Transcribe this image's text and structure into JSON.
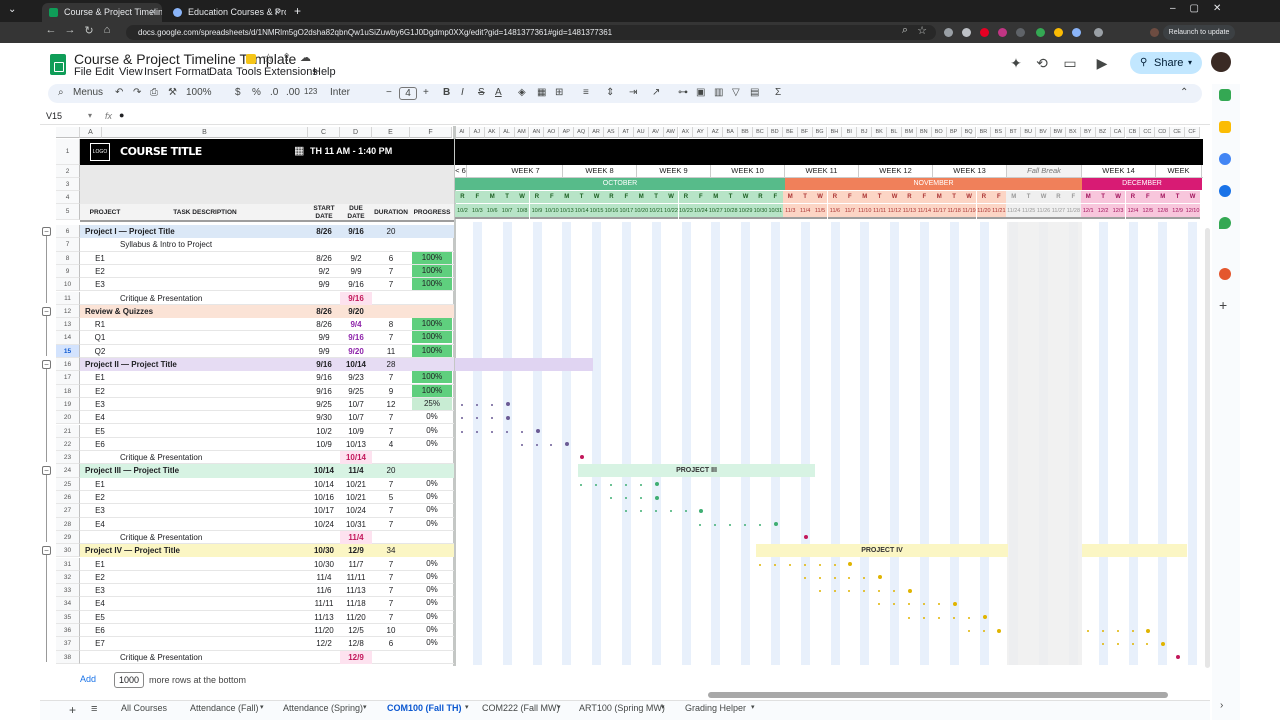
{
  "browser": {
    "tabs": [
      {
        "title": "Course & Project Timeline Templat",
        "active": true
      },
      {
        "title": "Education Courses & Projects T",
        "active": false
      }
    ],
    "url": "docs.google.com/spreadsheets/d/1NMRlm5gO2dsha82qbnQw1uSiZuwby6G1J0Dgdmp0XXg/edit?gid=1481377361#gid=1481377361",
    "relaunch_label": "Relaunch to update"
  },
  "doc": {
    "title": "Course & Project Timeline Template",
    "menus": [
      "File",
      "Edit",
      "View",
      "Insert",
      "Format",
      "Data",
      "Tools",
      "Extensions",
      "Help"
    ],
    "share_label": "Share"
  },
  "toolbar": {
    "menus_label": "Menus",
    "zoom": "100%",
    "currency": "$",
    "percent": "%",
    "dec_less": ".0",
    "dec_more": ".00",
    "format123": "123",
    "font": "Inter",
    "font_size": "4"
  },
  "formula": {
    "cell_ref": "V15",
    "fx": "fx",
    "content": "●"
  },
  "columns": [
    "A",
    "B",
    "C",
    "D",
    "E",
    "F"
  ],
  "timeline_columns": [
    "AI",
    "AJ",
    "AK",
    "AL",
    "AM",
    "AN",
    "AO",
    "AP",
    "AQ",
    "AR",
    "AS",
    "AT",
    "AU",
    "AV",
    "AW",
    "AX",
    "AY",
    "AZ",
    "BA",
    "BB",
    "BC",
    "BD",
    "BE",
    "BF",
    "BG",
    "BH",
    "BI",
    "BJ",
    "BK",
    "BL",
    "BM",
    "BN",
    "BO",
    "BP",
    "BQ",
    "BR",
    "BS",
    "BT",
    "BU",
    "BV",
    "BW",
    "BX",
    "BY",
    "BZ",
    "CA",
    "CB",
    "CC",
    "CD",
    "CE",
    "CF"
  ],
  "header": {
    "logo": "LOGO",
    "course_title": "COURSE TITLE",
    "schedule": "TH 11 AM - 1:40 PM",
    "col_labels": {
      "project": "PROJECT",
      "task": "TASK DESCRIPTION",
      "start": "START DATE",
      "due": "DUE DATE",
      "duration": "DURATION",
      "progress": "PROGRESS"
    }
  },
  "weeks": [
    "< 6",
    "WEEK 7",
    "WEEK 8",
    "WEEK 9",
    "WEEK 10",
    "WEEK 11",
    "WEEK 12",
    "WEEK 13",
    "Fall Break",
    "WEEK 14",
    "WEEK"
  ],
  "months": [
    "OCTOBER",
    "NOVEMBER",
    "DECEMBER"
  ],
  "day_letters": [
    "R",
    "F",
    "M",
    "T",
    "W",
    "R",
    "F",
    "M",
    "T",
    "W",
    "R",
    "F",
    "M",
    "T",
    "W",
    "R",
    "F",
    "M",
    "T",
    "W",
    "R",
    "F",
    "M",
    "T",
    "W",
    "R",
    "F",
    "M",
    "T",
    "W",
    "R",
    "F",
    "M",
    "T",
    "W",
    "R",
    "F",
    "M",
    "T",
    "W",
    "R",
    "F",
    "M",
    "T",
    "W",
    "R",
    "F",
    "M",
    "T",
    "W"
  ],
  "day_dates": [
    "10/2",
    "10/3",
    "10/6",
    "10/7",
    "10/8",
    "10/9",
    "10/10",
    "10/13",
    "10/14",
    "10/15",
    "10/16",
    "10/17",
    "10/20",
    "10/21",
    "10/22",
    "10/23",
    "10/24",
    "10/27",
    "10/28",
    "10/29",
    "10/30",
    "10/31",
    "11/3",
    "11/4",
    "11/5",
    "11/6",
    "11/7",
    "11/10",
    "11/11",
    "11/12",
    "11/13",
    "11/14",
    "11/17",
    "11/18",
    "11/19",
    "11/20",
    "11/21",
    "11/24",
    "11/25",
    "11/26",
    "11/27",
    "11/28",
    "12/1",
    "12/2",
    "12/3",
    "12/4",
    "12/5",
    "12/8",
    "12/9",
    "12/10"
  ],
  "rows": [
    {
      "n": "6",
      "type": "project",
      "a": "Project I — Project Title",
      "c": "8/26",
      "d": "9/16",
      "e": "20",
      "f": "",
      "color": "#dbe8f7"
    },
    {
      "n": "7",
      "type": "task",
      "a": "",
      "b": "Syllabus & Intro to Project",
      "c": "",
      "d": "",
      "e": "",
      "f": ""
    },
    {
      "n": "8",
      "type": "task",
      "a": "E1",
      "b": "",
      "c": "8/26",
      "d": "9/2",
      "e": "6",
      "f": "100%"
    },
    {
      "n": "9",
      "type": "task",
      "a": "E2",
      "b": "",
      "c": "9/2",
      "d": "9/9",
      "e": "7",
      "f": "100%"
    },
    {
      "n": "10",
      "type": "task",
      "a": "E3",
      "b": "",
      "c": "9/9",
      "d": "9/16",
      "e": "7",
      "f": "100%"
    },
    {
      "n": "11",
      "type": "crit",
      "a": "",
      "b": "Critique & Presentation",
      "c": "",
      "d": "9/16",
      "e": "",
      "f": ""
    },
    {
      "n": "12",
      "type": "project",
      "a": "Review & Quizzes",
      "c": "8/26",
      "d": "9/20",
      "e": "",
      "f": "",
      "color": "#fbe3d6"
    },
    {
      "n": "13",
      "type": "task",
      "a": "R1",
      "b": "",
      "c": "8/26",
      "d": "9/4",
      "e": "8",
      "f": "100%",
      "dbold": true
    },
    {
      "n": "14",
      "type": "task",
      "a": "Q1",
      "b": "",
      "c": "9/9",
      "d": "9/16",
      "e": "7",
      "f": "100%",
      "dbold": true
    },
    {
      "n": "15",
      "type": "task",
      "a": "Q2",
      "b": "",
      "c": "9/9",
      "d": "9/20",
      "e": "11",
      "f": "100%",
      "dbold": true
    },
    {
      "n": "16",
      "type": "project",
      "a": "Project II — Project Title",
      "c": "9/16",
      "d": "10/14",
      "e": "28",
      "f": "",
      "color": "#e6dcf3"
    },
    {
      "n": "17",
      "type": "task",
      "a": "E1",
      "b": "",
      "c": "9/16",
      "d": "9/23",
      "e": "7",
      "f": "100%"
    },
    {
      "n": "18",
      "type": "task",
      "a": "E2",
      "b": "",
      "c": "9/16",
      "d": "9/25",
      "e": "9",
      "f": "100%"
    },
    {
      "n": "19",
      "type": "task",
      "a": "E3",
      "b": "",
      "c": "9/25",
      "d": "10/7",
      "e": "12",
      "f": "25%"
    },
    {
      "n": "20",
      "type": "task",
      "a": "E4",
      "b": "",
      "c": "9/30",
      "d": "10/7",
      "e": "7",
      "f": "0%"
    },
    {
      "n": "21",
      "type": "task",
      "a": "E5",
      "b": "",
      "c": "10/2",
      "d": "10/9",
      "e": "7",
      "f": "0%"
    },
    {
      "n": "22",
      "type": "task",
      "a": "E6",
      "b": "",
      "c": "10/9",
      "d": "10/13",
      "e": "4",
      "f": "0%"
    },
    {
      "n": "23",
      "type": "crit",
      "a": "",
      "b": "Critique & Presentation",
      "c": "",
      "d": "10/14",
      "e": "",
      "f": ""
    },
    {
      "n": "24",
      "type": "project",
      "a": "Project III — Project Title",
      "c": "10/14",
      "d": "11/4",
      "e": "20",
      "f": "",
      "color": "#d7f3e3"
    },
    {
      "n": "25",
      "type": "task",
      "a": "E1",
      "b": "",
      "c": "10/14",
      "d": "10/21",
      "e": "7",
      "f": "0%"
    },
    {
      "n": "26",
      "type": "task",
      "a": "E2",
      "b": "",
      "c": "10/16",
      "d": "10/21",
      "e": "5",
      "f": "0%"
    },
    {
      "n": "27",
      "type": "task",
      "a": "E3",
      "b": "",
      "c": "10/17",
      "d": "10/24",
      "e": "7",
      "f": "0%"
    },
    {
      "n": "28",
      "type": "task",
      "a": "E4",
      "b": "",
      "c": "10/24",
      "d": "10/31",
      "e": "7",
      "f": "0%"
    },
    {
      "n": "29",
      "type": "crit",
      "a": "",
      "b": "Critique & Presentation",
      "c": "",
      "d": "11/4",
      "e": "",
      "f": ""
    },
    {
      "n": "30",
      "type": "project",
      "a": "Project IV — Project Title",
      "c": "10/30",
      "d": "12/9",
      "e": "34",
      "f": "",
      "color": "#fbf6c4"
    },
    {
      "n": "31",
      "type": "task",
      "a": "E1",
      "b": "",
      "c": "10/30",
      "d": "11/7",
      "e": "7",
      "f": "0%"
    },
    {
      "n": "32",
      "type": "task",
      "a": "E2",
      "b": "",
      "c": "11/4",
      "d": "11/11",
      "e": "7",
      "f": "0%"
    },
    {
      "n": "33",
      "type": "task",
      "a": "E3",
      "b": "",
      "c": "11/6",
      "d": "11/13",
      "e": "7",
      "f": "0%"
    },
    {
      "n": "34",
      "type": "task",
      "a": "E4",
      "b": "",
      "c": "11/11",
      "d": "11/18",
      "e": "7",
      "f": "0%"
    },
    {
      "n": "35",
      "type": "task",
      "a": "E5",
      "b": "",
      "c": "11/13",
      "d": "11/20",
      "e": "7",
      "f": "0%"
    },
    {
      "n": "36",
      "type": "task",
      "a": "E6",
      "b": "",
      "c": "11/20",
      "d": "12/5",
      "e": "10",
      "f": "0%"
    },
    {
      "n": "37",
      "type": "task",
      "a": "E7",
      "b": "",
      "c": "12/2",
      "d": "12/8",
      "e": "6",
      "f": "0%"
    },
    {
      "n": "38",
      "type": "crit",
      "a": "",
      "b": "Critique & Presentation",
      "c": "",
      "d": "12/9",
      "e": "",
      "f": ""
    }
  ],
  "gantt_labels": {
    "project3": "PROJECT III",
    "project4": "PROJECT IV"
  },
  "footer": {
    "add_label": "Add",
    "rows_value": "1000",
    "rows_suffix": "more rows at the bottom"
  },
  "sheet_tabs": [
    "All Courses",
    "Attendance (Fall)",
    "Attendance (Spring)",
    "COM100 (Fall TH)",
    "COM222 (Fall MW)",
    "ART100 (Spring MW)",
    "Grading Helper"
  ],
  "active_sheet": "COM100 (Fall TH)",
  "colors": {
    "green": "#57bb8a",
    "orange": "#f0805a",
    "magenta": "#d81b74",
    "done": "#5fcf7e",
    "accent": "#c2e7ff"
  }
}
